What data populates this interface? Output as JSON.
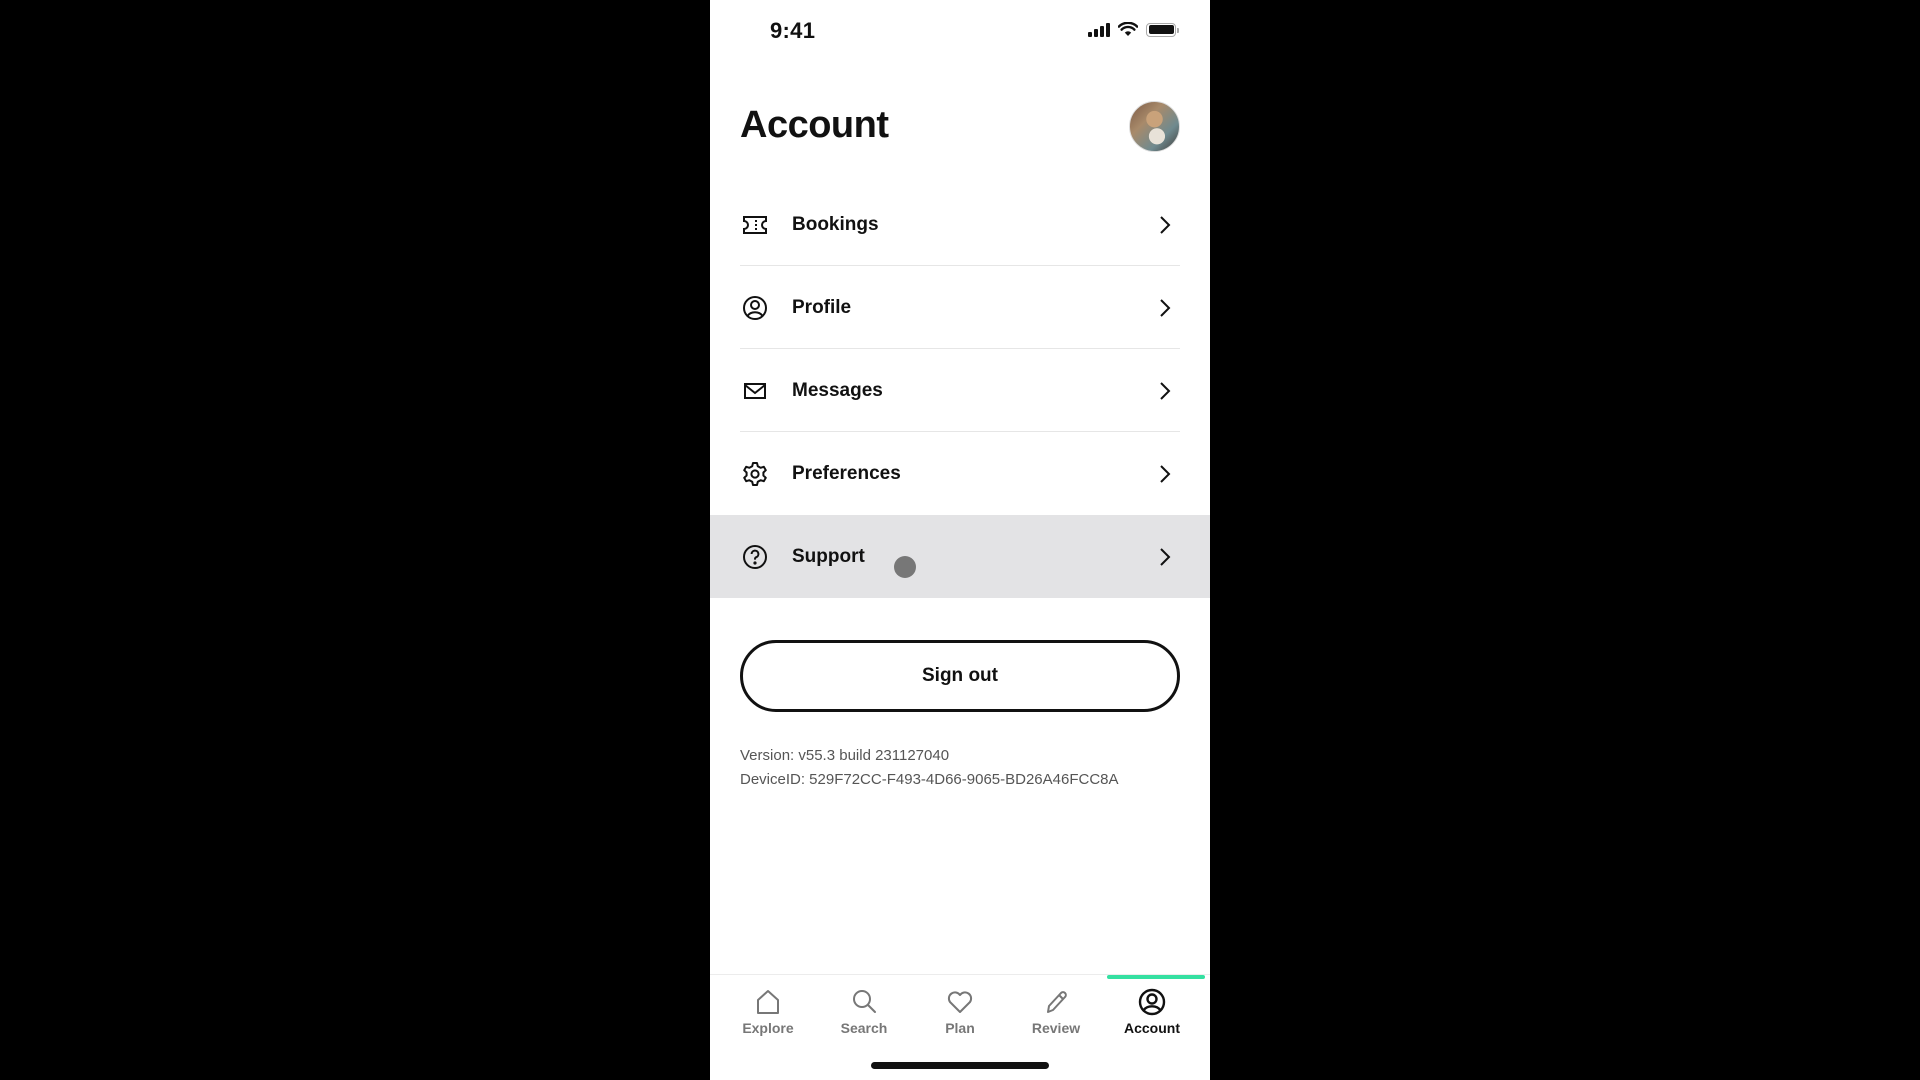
{
  "status_bar": {
    "time": "9:41"
  },
  "header": {
    "title": "Account",
    "avatar_alt": "profile-photo"
  },
  "menu": {
    "items": [
      {
        "label": "Bookings",
        "icon": "ticket-icon"
      },
      {
        "label": "Profile",
        "icon": "user-circle-icon"
      },
      {
        "label": "Messages",
        "icon": "envelope-icon"
      },
      {
        "label": "Preferences",
        "icon": "gear-icon"
      },
      {
        "label": "Support",
        "icon": "question-circle-icon",
        "highlighted": true
      }
    ]
  },
  "sign_out": {
    "label": "Sign out"
  },
  "app_info": {
    "version": "Version: v55.3 build 231127040",
    "device_id": "DeviceID: 529F72CC-F493-4D66-9065-BD26A46FCC8A"
  },
  "tab_bar": {
    "accent_color": "#34e0a1",
    "tabs": [
      {
        "label": "Explore",
        "icon": "home-icon"
      },
      {
        "label": "Search",
        "icon": "search-icon"
      },
      {
        "label": "Plan",
        "icon": "heart-icon"
      },
      {
        "label": "Review",
        "icon": "pencil-icon"
      },
      {
        "label": "Account",
        "icon": "account-icon",
        "selected": true
      }
    ]
  }
}
